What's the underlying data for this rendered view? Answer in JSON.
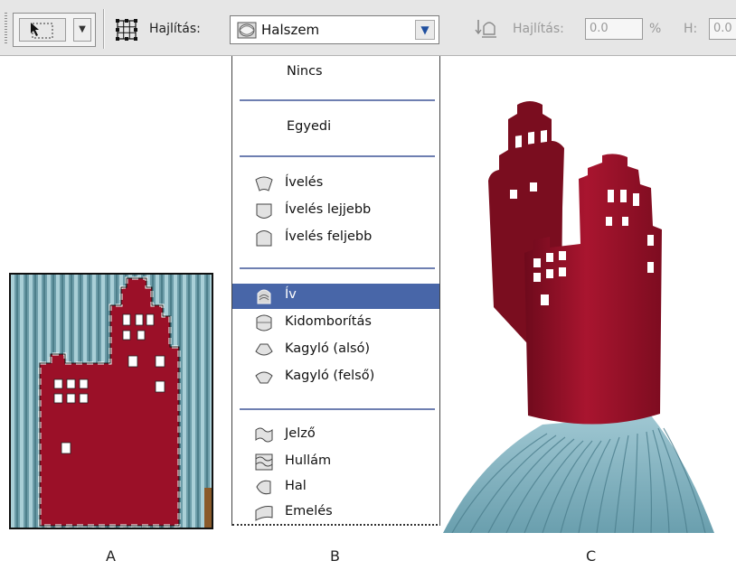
{
  "toolbar": {
    "warp_label": "Hajlítás:",
    "style_selected": "Halszem",
    "bend_label": "Hajlítás:",
    "bend_value": "0.0",
    "percent_unit": "%",
    "h_label": "H:",
    "h_value": "0.0"
  },
  "menu": {
    "items": [
      {
        "label": "Nincs",
        "icon": ""
      },
      {
        "label": "Egyedi",
        "icon": ""
      },
      {
        "label": "Ívelés",
        "icon": "arc-icon"
      },
      {
        "label": "Ívelés lejjebb",
        "icon": "arc-lower-icon"
      },
      {
        "label": "Ívelés feljebb",
        "icon": "arc-upper-icon"
      },
      {
        "label": "Ív",
        "icon": "arch-icon"
      },
      {
        "label": "Kidomborítás",
        "icon": "bulge-icon"
      },
      {
        "label": "Kagyló (alsó)",
        "icon": "shell-lower-icon"
      },
      {
        "label": "Kagyló (felső)",
        "icon": "shell-upper-icon"
      },
      {
        "label": "Jelző",
        "icon": "flag-icon"
      },
      {
        "label": "Hullám",
        "icon": "wave-icon"
      },
      {
        "label": "Hal",
        "icon": "fish-icon"
      },
      {
        "label": "Emelés",
        "icon": "rise-icon"
      }
    ],
    "selected_index": 5
  },
  "captions": {
    "a": "A",
    "b": "B",
    "c": "C"
  },
  "colors": {
    "selection": "#4866a8",
    "building": "#9b1028",
    "background_stripes": "#7fb1bd"
  }
}
